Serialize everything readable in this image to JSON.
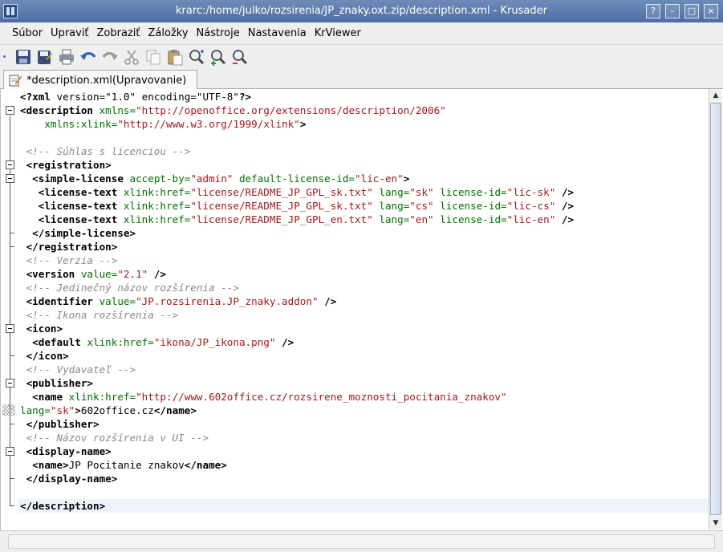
{
  "window": {
    "title": "krarc:/home/julko/rozsirenia/JP_znaky.oxt.zip/description.xml - Krusader",
    "controls": {
      "help": "?",
      "minimize": "–",
      "maximize": "□",
      "close": "×"
    }
  },
  "menubar": {
    "items": [
      "Súbor",
      "Upraviť",
      "Zobraziť",
      "Záložky",
      "Nástroje",
      "Nastavenia",
      "KrViewer"
    ]
  },
  "toolbar": {
    "icons": [
      "save-icon",
      "save-as-icon",
      "print-icon",
      "undo-icon",
      "redo-icon",
      "cut-icon",
      "copy-icon",
      "paste-icon",
      "find-icon",
      "zoom-in-icon",
      "zoom-out-icon"
    ]
  },
  "tab": {
    "label": "*description.xml(Upravovanie)"
  },
  "editor": {
    "lines": [
      [
        {
          "c": "tag",
          "t": "<?xml "
        },
        {
          "c": "txt",
          "t": "version=\"1.0\" encoding=\"UTF-8\""
        },
        {
          "c": "tag",
          "t": "?>"
        }
      ],
      [
        {
          "c": "tag",
          "t": "<description "
        },
        {
          "c": "attr",
          "t": "xmlns="
        },
        {
          "c": "val",
          "t": "\"http://openoffice.org/extensions/description/2006\""
        }
      ],
      [
        {
          "c": "txt",
          "t": "    "
        },
        {
          "c": "attr",
          "t": "xmlns:xlink="
        },
        {
          "c": "val",
          "t": "\"http://www.w3.org/1999/xlink\""
        },
        {
          "c": "tag",
          "t": ">"
        }
      ],
      [],
      [
        {
          "c": "com",
          "t": " <!-- Súhlas s licenciou -->"
        }
      ],
      [
        {
          "c": "tag",
          "t": " <registration>"
        }
      ],
      [
        {
          "c": "tag",
          "t": "  <simple-license "
        },
        {
          "c": "attr",
          "t": "accept-by="
        },
        {
          "c": "val",
          "t": "\"admin\""
        },
        {
          "c": "attr",
          "t": " default-license-id="
        },
        {
          "c": "val",
          "t": "\"lic-en\""
        },
        {
          "c": "tag",
          "t": ">"
        }
      ],
      [
        {
          "c": "tag",
          "t": "   <license-text "
        },
        {
          "c": "attr",
          "t": "xlink:href="
        },
        {
          "c": "val",
          "t": "\"license/README_JP_GPL_sk.txt\""
        },
        {
          "c": "attr",
          "t": " lang="
        },
        {
          "c": "val",
          "t": "\"sk\""
        },
        {
          "c": "attr",
          "t": " license-id="
        },
        {
          "c": "val",
          "t": "\"lic-sk\""
        },
        {
          "c": "tag",
          "t": " />"
        }
      ],
      [
        {
          "c": "tag",
          "t": "   <license-text "
        },
        {
          "c": "attr",
          "t": "xlink:href="
        },
        {
          "c": "val",
          "t": "\"license/README_JP_GPL_sk.txt\""
        },
        {
          "c": "attr",
          "t": " lang="
        },
        {
          "c": "val",
          "t": "\"cs\""
        },
        {
          "c": "attr",
          "t": " license-id="
        },
        {
          "c": "val",
          "t": "\"lic-cs\""
        },
        {
          "c": "tag",
          "t": " />"
        }
      ],
      [
        {
          "c": "tag",
          "t": "   <license-text "
        },
        {
          "c": "attr",
          "t": "xlink:href="
        },
        {
          "c": "val",
          "t": "\"license/README_JP_GPL_en.txt\""
        },
        {
          "c": "attr",
          "t": " lang="
        },
        {
          "c": "val",
          "t": "\"en\""
        },
        {
          "c": "attr",
          "t": " license-id="
        },
        {
          "c": "val",
          "t": "\"lic-en\""
        },
        {
          "c": "tag",
          "t": " />"
        }
      ],
      [
        {
          "c": "tag",
          "t": "  </simple-license>"
        }
      ],
      [
        {
          "c": "tag",
          "t": " </registration>"
        }
      ],
      [
        {
          "c": "com",
          "t": " <!-- Verzia -->"
        }
      ],
      [
        {
          "c": "tag",
          "t": " <version "
        },
        {
          "c": "attr",
          "t": "value="
        },
        {
          "c": "val",
          "t": "\"2.1\""
        },
        {
          "c": "tag",
          "t": " />"
        }
      ],
      [
        {
          "c": "com",
          "t": " <!-- Jedinečný názov rozšírenia -->"
        }
      ],
      [
        {
          "c": "tag",
          "t": " <identifier "
        },
        {
          "c": "attr",
          "t": "value="
        },
        {
          "c": "val",
          "t": "\"JP.rozsirenia.JP_znaky.addon\""
        },
        {
          "c": "tag",
          "t": " />"
        }
      ],
      [
        {
          "c": "com",
          "t": " <!-- Ikona rozšírenia -->"
        }
      ],
      [
        {
          "c": "tag",
          "t": " <icon>"
        }
      ],
      [
        {
          "c": "tag",
          "t": "  <default "
        },
        {
          "c": "attr",
          "t": "xlink:href="
        },
        {
          "c": "val",
          "t": "\"ikona/JP_ikona.png\""
        },
        {
          "c": "tag",
          "t": " />"
        }
      ],
      [
        {
          "c": "tag",
          "t": " </icon>"
        }
      ],
      [
        {
          "c": "com",
          "t": " <!-- Vydavateľ -->"
        }
      ],
      [
        {
          "c": "tag",
          "t": " <publisher>"
        }
      ],
      [
        {
          "c": "tag",
          "t": "  <name "
        },
        {
          "c": "attr",
          "t": "xlink:href="
        },
        {
          "c": "val",
          "t": "\"http://www.602office.cz/rozsirene_moznosti_pocitania_znakov\""
        }
      ],
      [
        {
          "c": "attr",
          "t": "lang="
        },
        {
          "c": "val",
          "t": "\"sk\""
        },
        {
          "c": "tag",
          "t": ">"
        },
        {
          "c": "txt",
          "t": "602office.cz"
        },
        {
          "c": "tag",
          "t": "</name>"
        }
      ],
      [
        {
          "c": "tag",
          "t": " </publisher>"
        }
      ],
      [
        {
          "c": "com",
          "t": " <!-- Názov rozšírenia v UI -->"
        }
      ],
      [
        {
          "c": "tag",
          "t": " <display-name>"
        }
      ],
      [
        {
          "c": "tag",
          "t": "  <name>"
        },
        {
          "c": "txt",
          "t": "JP Pocitanie znakov"
        },
        {
          "c": "tag",
          "t": "</name>"
        }
      ],
      [
        {
          "c": "tag",
          "t": " </display-name>"
        }
      ],
      [],
      [
        {
          "c": "tag",
          "t": "</description>"
        }
      ]
    ],
    "current_line": 31
  }
}
